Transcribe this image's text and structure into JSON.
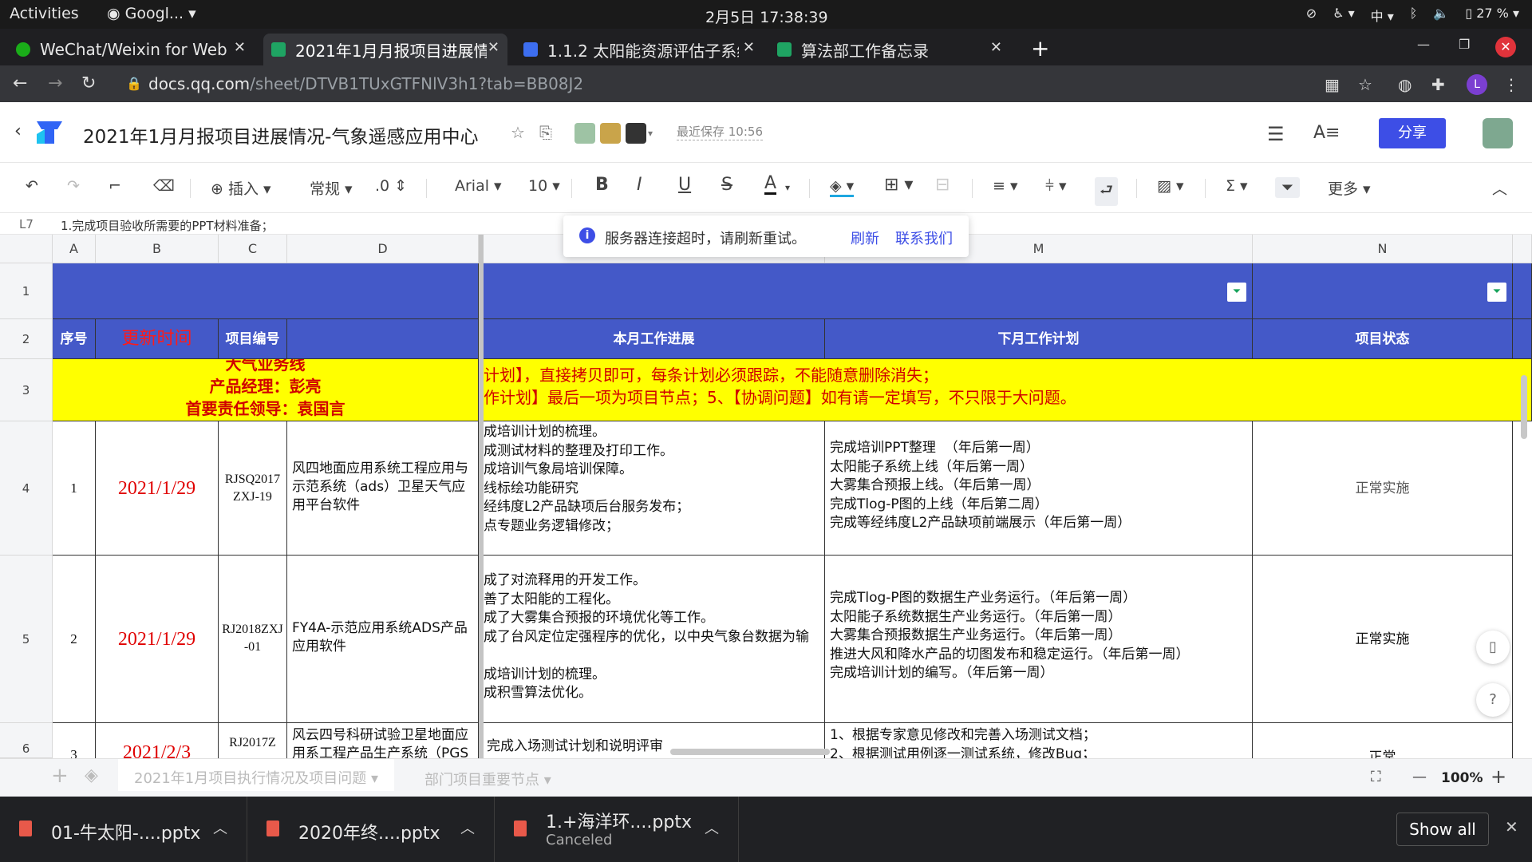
{
  "topbar": {
    "activities": "Activities",
    "app": "Googl...",
    "clock": "2月5日  17:38:39",
    "ime": "中",
    "battery": "27 %"
  },
  "tabs": [
    {
      "title": "WeChat/Weixin for Web",
      "color": "#1aad19"
    },
    {
      "title": "2021年1月月报项目进展情况",
      "color": "#1fa463"
    },
    {
      "title": "1.1.2 太阳能资源评估子系统",
      "color": "#3d6ef0"
    },
    {
      "title": "算法部工作备忘录",
      "color": "#1fa463"
    }
  ],
  "address": {
    "host": "docs.qq.com",
    "path": "/sheet/DTVB1TUxGTFNlV3h1?tab=BB08J2"
  },
  "avatar_letter": "L",
  "doc": {
    "title": "2021年1月月报项目进展情况-气象遥感应用中心",
    "saved": "最近保存 10:56",
    "share": "分享"
  },
  "toolbar": {
    "insert": "插入",
    "format": "常规",
    "decimal": ".0",
    "font": "Arial",
    "size": "10",
    "more": "更多"
  },
  "formula": {
    "ref": "L7",
    "content": "1.完成项目验收所需要的PPT材料准备；"
  },
  "toast": {
    "message": "服务器连接超时，请刷新重试。",
    "refresh": "刷新",
    "contact": "联系我们"
  },
  "columns": [
    "A",
    "B",
    "C",
    "D",
    "M",
    "N"
  ],
  "rows": [
    "1",
    "2",
    "3",
    "4",
    "5",
    "6"
  ],
  "header": {
    "seq": "序号",
    "update": "更新时间",
    "code": "项目编号",
    "progress": "本月工作进展",
    "plan": "下月工作计划",
    "status": "项目状态"
  },
  "banner": {
    "left1": "大气业务线",
    "left2": "产品经理：彭亮",
    "left3": "首要责任领导：袁国言",
    "right1": "计划】，直接拷贝即可，每条计划必须跟踪，不能随意删除消失；",
    "right2": "作计划】最后一项为项目节点；5、【协调问题】如有请一定填写，不只限于大问题。"
  },
  "data_rows": [
    {
      "seq": "1",
      "date": "2021/1/29",
      "code": "RJSQ2017ZXJ-19",
      "name": "风四地面应用系统工程应用与示范系统（ads）卫星天气应用平台软件",
      "progress": "成培训计划的梳理。\n成测试材料的整理及打印工作。\n成培训气象局培训保障。\n线标绘功能研究\n经纬度L2产品缺项后台服务发布；\n点专题业务逻辑修改；",
      "plan": "完成培训PPT整理  （年后第一周）\n太阳能子系统上线（年后第一周）\n大雾集合预报上线。（年后第一周）\n完成Tlog-P图的上线（年后第二周）\n完成等经纬度L2产品缺项前端展示（年后第一周）",
      "status": "正常实施"
    },
    {
      "seq": "2",
      "date": "2021/1/29",
      "code": "RJ2018ZXJ-01",
      "name": "FY4A-示范应用系统ADS产品应用软件",
      "progress": "成了对流释用的开发工作。\n善了太阳能的工程化。\n成了大雾集合预报的环境优化等工作。\n成了台风定位定强程序的优化，以中央气象台数据为输\n\n成培训计划的梳理。\n成积雪算法优化。",
      "plan": "完成Tlog-P图的数据生产业务运行。（年后第一周）\n太阳能子系统数据生产业务运行。（年后第一周）\n大雾集合预报数据生产业务运行。（年后第一周）\n推进大风和降水产品的切图发布和稳定运行。（年后第一周）\n完成培训计划的编写。（年后第一周）",
      "status": "正常实施"
    },
    {
      "seq": "3",
      "date": "2021/2/3",
      "code": "RJ2017Z",
      "name": "风云四号科研试验卫星地面应用系工程产品生产系统（PGS",
      "progress": "完成入场测试计划和说明评审",
      "plan": "1、根据专家意见修改和完善入场测试文档；\n2、根据测试用例逐一测试系统，修改Bug；",
      "status": "正常"
    }
  ],
  "sheets": {
    "sheet1": "2021年1月项目执行情况及项目问题",
    "sheet2": "部门项目重要节点",
    "zoom": "100%"
  },
  "downloads": [
    {
      "name": "01-牛太阳-....pptx",
      "sub": ""
    },
    {
      "name": "2020年终....pptx",
      "sub": ""
    },
    {
      "name": "1.+海洋环....pptx",
      "sub": "Canceled"
    }
  ],
  "show_all": "Show all",
  "colors": {
    "header_blue": "#4459c8",
    "banner_yellow": "#ffff00",
    "accent": "#3d4ee6",
    "date_red": "#e00000"
  }
}
